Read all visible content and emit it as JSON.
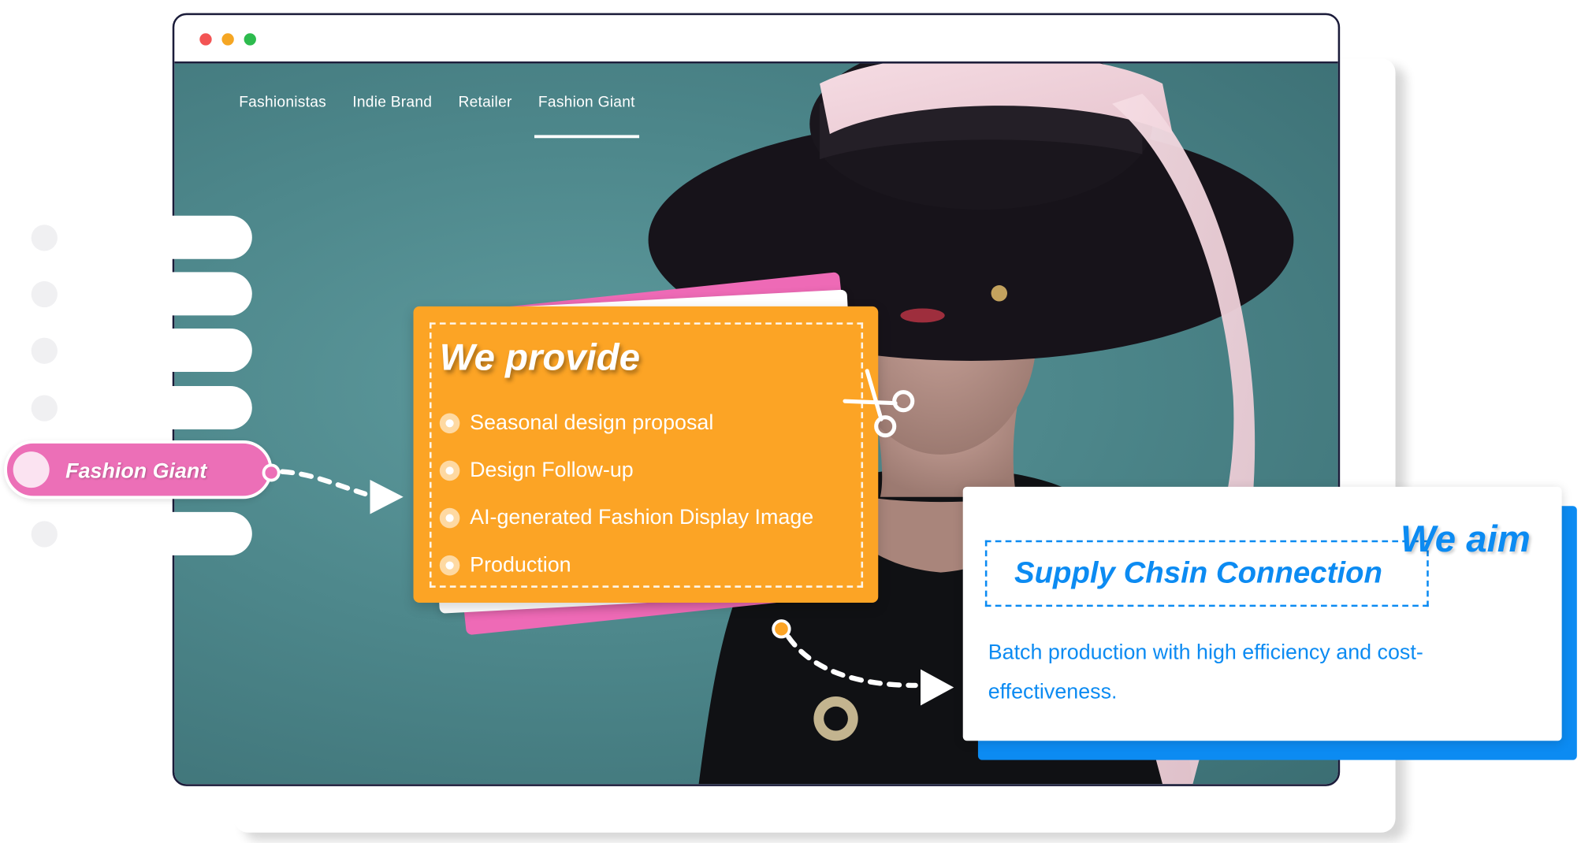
{
  "window": {
    "controls": [
      "close",
      "minimize",
      "maximize"
    ]
  },
  "nav": {
    "items": [
      "Fashionistas",
      "Indie Brand",
      "Retailer",
      "Fashion Giant"
    ],
    "active_index": 3
  },
  "side_tag": {
    "label": "Fashion Giant"
  },
  "provide_card": {
    "title": "We provide",
    "items": [
      "Seasonal design proposal",
      "Design Follow-up",
      "AI-generated Fashion Display Image",
      "Production"
    ]
  },
  "aim_card": {
    "title": "We aim",
    "highlight": "Supply Chsin Connection",
    "description": "Batch production with high efficiency and cost-effectiveness."
  },
  "colors": {
    "orange": "#fca425",
    "pink": "#ec6fb7",
    "blue": "#0c8bf2",
    "dark_frame": "#1b1c3a",
    "teal_bg": "#4d878b"
  },
  "icons": [
    "scissors-icon",
    "arrow-right-icon"
  ]
}
